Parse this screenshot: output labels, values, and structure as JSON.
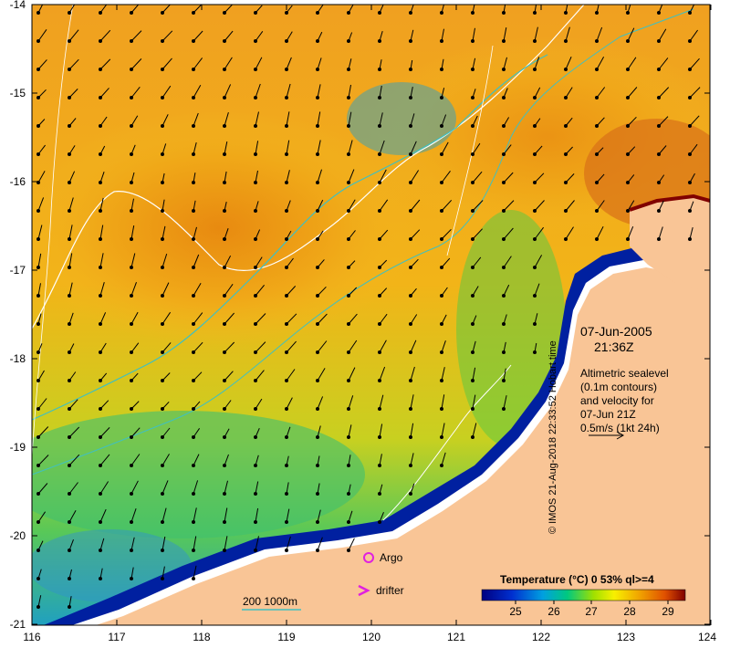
{
  "map": {
    "x_ticks": [
      "116",
      "117",
      "118",
      "119",
      "120",
      "121",
      "122",
      "123",
      "124"
    ],
    "y_ticks": [
      "-14",
      "-15",
      "-16",
      "-17",
      "-18",
      "-19",
      "-20",
      "-21"
    ],
    "lon_range": [
      116,
      124
    ],
    "lat_range": [
      -21,
      -14
    ]
  },
  "annotation": {
    "date": "07-Jun-2005",
    "time": "21:36Z",
    "lines": [
      "Altimetric sealevel",
      "(0.1m contours)",
      "and velocity for",
      "07-Jun 21Z",
      "0.5m/s (1kt 24h)"
    ]
  },
  "legend": {
    "argo_label": "Argo",
    "drifter_label": "drifter",
    "scale_label": "200  1000m",
    "colorbar_title": "Temperature (°C) 0 53% ql>=4",
    "colorbar_ticks": [
      "25",
      "26",
      "27",
      "28",
      "29"
    ],
    "colors": {
      "argo": "#e020e0",
      "drifter": "#e020e0",
      "isobath": "#40c0c0",
      "contour": "#ffffff",
      "land": "#f9c596"
    }
  },
  "credit": "© IMOS 21-Aug-2018 22:33:52 Hobart time"
}
